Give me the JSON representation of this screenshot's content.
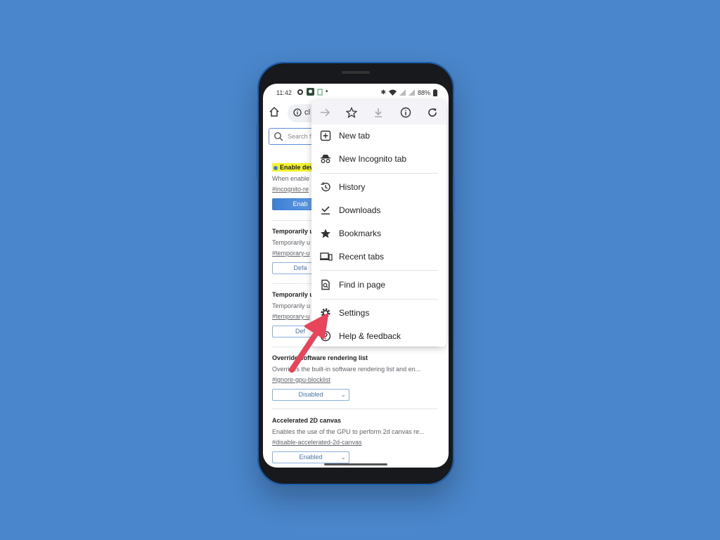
{
  "status_bar": {
    "time": "11:42",
    "battery": "88%"
  },
  "url_bar": {
    "text": "cl"
  },
  "page": {
    "search_placeholder": "Search f",
    "flags": [
      {
        "title": "Enable dev",
        "desc": "When enable",
        "link": "#incognito-re",
        "select": "Enab",
        "highlighted": true
      },
      {
        "title": "Temporarily u",
        "desc": "Temporarily u",
        "link": "#temporary-u",
        "select": "Defa"
      },
      {
        "title": "Temporarily u",
        "desc": "Temporarily u",
        "link": "#temporary-u",
        "select": "Def"
      },
      {
        "title": "Override software rendering list",
        "desc": "Overrides the built-in software rendering list and en...",
        "link": "#ignore-gpu-blocklist",
        "select": "Disabled"
      },
      {
        "title": "Accelerated 2D canvas",
        "desc": "Enables the use of the GPU to perform 2d canvas re...",
        "link": "#disable-accelerated-2d-canvas",
        "select": "Enabled"
      }
    ]
  },
  "menu": {
    "toolbar_icons": [
      "forward-icon",
      "star-icon",
      "download-icon",
      "info-icon",
      "reload-icon"
    ],
    "items": [
      {
        "label": "New tab",
        "icon": "plus-box-icon"
      },
      {
        "label": "New Incognito tab",
        "icon": "incognito-icon"
      },
      {
        "label": "History",
        "icon": "history-icon"
      },
      {
        "label": "Downloads",
        "icon": "download-check-icon"
      },
      {
        "label": "Bookmarks",
        "icon": "star-filled-icon"
      },
      {
        "label": "Recent tabs",
        "icon": "devices-icon"
      },
      {
        "label": "Find in page",
        "icon": "find-in-page-icon"
      },
      {
        "label": "Settings",
        "icon": "gear-icon"
      },
      {
        "label": "Help & feedback",
        "icon": "help-icon"
      }
    ]
  },
  "colors": {
    "background": "#4a86cb",
    "arrow": "#e8445a",
    "highlight": "#f5f32a",
    "accent": "#3e7fd6"
  }
}
